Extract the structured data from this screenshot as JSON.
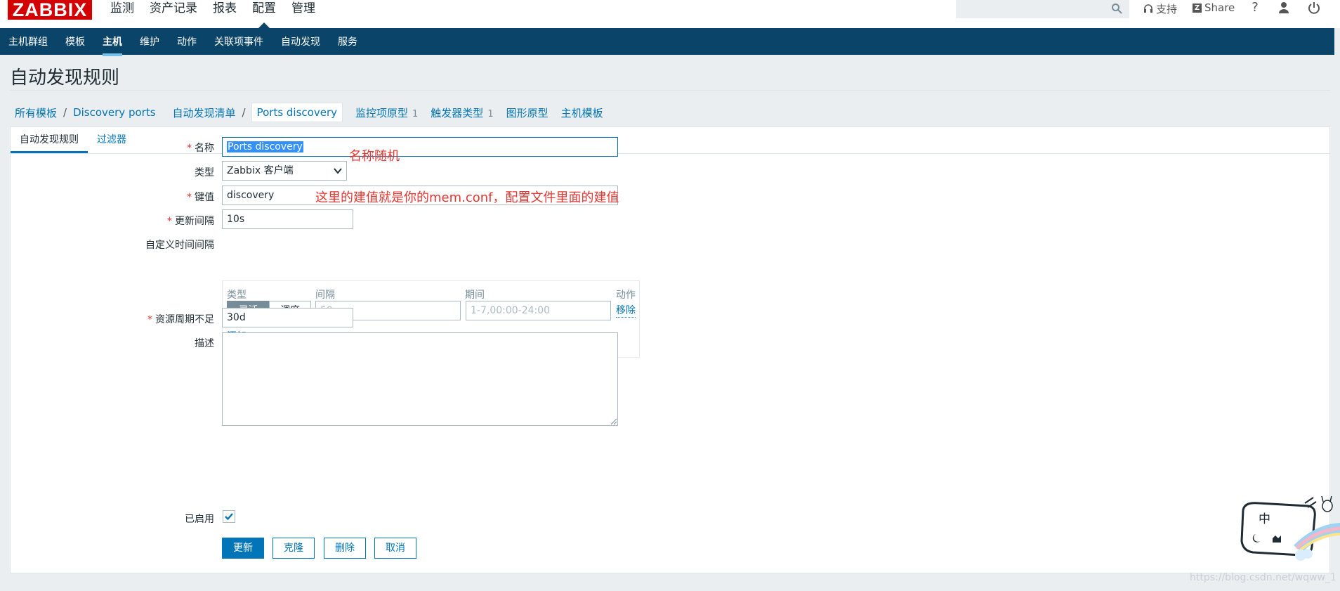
{
  "logo": "ZABBIX",
  "top_menu": [
    {
      "label": "监测",
      "active": false
    },
    {
      "label": "资产记录",
      "active": false
    },
    {
      "label": "报表",
      "active": false
    },
    {
      "label": "配置",
      "active": true
    },
    {
      "label": "管理",
      "active": false
    }
  ],
  "header": {
    "search_value": "",
    "support_label": "支持",
    "share_label": "Share",
    "help_icon": "help-icon",
    "user_icon": "user-icon",
    "logout_icon": "power-icon"
  },
  "sub_menu": [
    {
      "label": "主机群组",
      "active": false
    },
    {
      "label": "模板",
      "active": false
    },
    {
      "label": "主机",
      "active": true
    },
    {
      "label": "维护",
      "active": false
    },
    {
      "label": "动作",
      "active": false
    },
    {
      "label": "关联项事件",
      "active": false
    },
    {
      "label": "自动发现",
      "active": false
    },
    {
      "label": "服务",
      "active": false
    }
  ],
  "page_title": "自动发现规则",
  "breadcrumb": {
    "items": [
      "所有模板",
      "Discovery ports",
      "自动发现清单",
      "Ports discovery"
    ],
    "tabs": [
      {
        "label": "监控项原型",
        "count": "1"
      },
      {
        "label": "触发器类型",
        "count": "1"
      },
      {
        "label": "图形原型",
        "count": ""
      },
      {
        "label": "主机模板",
        "count": ""
      }
    ]
  },
  "form_tabs": [
    "自动发现规则",
    "过滤器"
  ],
  "form": {
    "name_label": "名称",
    "name_value": "Ports discovery",
    "type_label": "类型",
    "type_value": "Zabbix 客户端",
    "key_label": "键值",
    "key_value": "discovery",
    "interval_label": "更新间隔",
    "interval_value": "10s",
    "custom_interval_label": "自定义时间间隔",
    "custom_interval": {
      "col_type": "类型",
      "col_interval": "间隔",
      "col_period": "期间",
      "col_action": "动作",
      "seg_flexible": "灵活",
      "seg_scheduling": "调度",
      "interval_placeholder": "50s",
      "period_placeholder": "1-7,00:00-24:00",
      "remove_label": "移除",
      "add_label": "添加"
    },
    "lifetime_label": "资源周期不足",
    "lifetime_value": "30d",
    "description_label": "描述",
    "description_value": "",
    "enabled_label": "已启用",
    "enabled": true
  },
  "buttons": {
    "update": "更新",
    "clone": "克隆",
    "delete": "删除",
    "cancel": "取消"
  },
  "annotations": {
    "name_note": "名称随机",
    "key_note": "这里的建值就是你的mem.conf，配置文件里面的建值"
  },
  "mascot_glyph": "中",
  "watermark": "https://blog.csdn.net/wqww_1"
}
